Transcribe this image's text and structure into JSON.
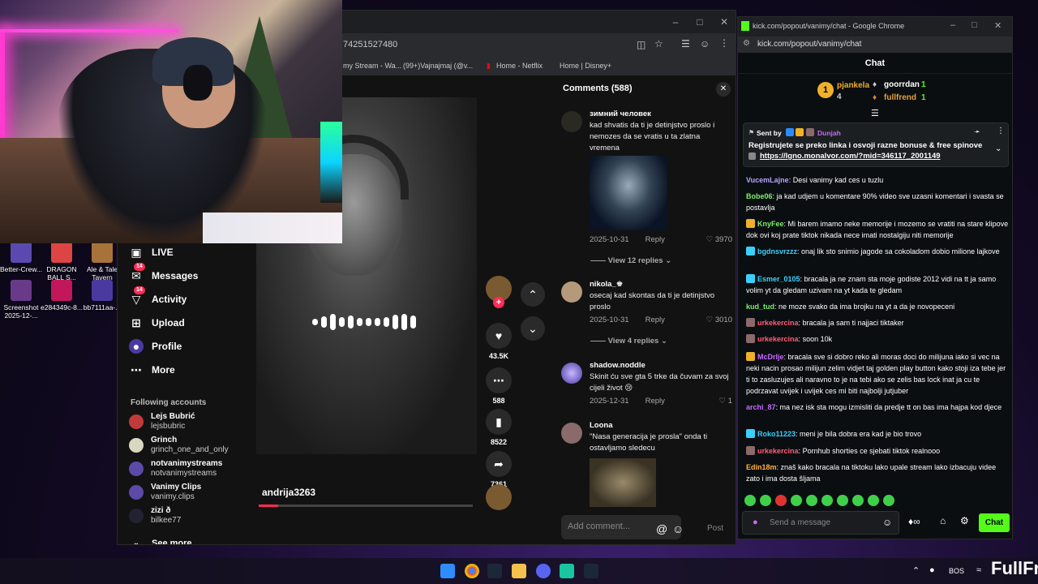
{
  "desktop_icons": [
    {
      "label": "Better-Crew..."
    },
    {
      "label": "DRAGON BALL S..."
    },
    {
      "label": "Ale & Tale Tavern"
    },
    {
      "label": "Screenshot 2025-12-..."
    },
    {
      "label": "e284349c-8..."
    },
    {
      "label": "bb7111aa-..."
    }
  ],
  "browser": {
    "url_fragment": "74251527480",
    "bookmarks": [
      "my Stream - Wa...",
      "(99+)Vajnajmaj (@v...",
      "Home - Netflix",
      "Home | Disney+"
    ]
  },
  "tiktok": {
    "nav": [
      {
        "label": "LIVE",
        "icon": "live-icon"
      },
      {
        "label": "Messages",
        "icon": "messages-icon",
        "badge": "14"
      },
      {
        "label": "Activity",
        "icon": "activity-icon",
        "badge": "14"
      },
      {
        "label": "Upload",
        "icon": "upload-icon"
      },
      {
        "label": "Profile",
        "icon": "profile-icon"
      },
      {
        "label": "More",
        "icon": "more-icon"
      }
    ],
    "following_header": "Following accounts",
    "following": [
      {
        "name": "Lejs Bubrić",
        "handle": "lejsbubric"
      },
      {
        "name": "Grinch",
        "handle": "grinch_one_and_only"
      },
      {
        "name": "notvanimystreams",
        "handle": "notvanimystreams"
      },
      {
        "name": "Vanimy Clips",
        "handle": "vanimy.clips"
      },
      {
        "name": "zizi ð",
        "handle": "bilkee77"
      }
    ],
    "see_more": "See more",
    "video_author": "andrija3263",
    "video_progress": 0.09,
    "actions": {
      "likes": "43.5K",
      "comments": "588",
      "saves": "8522",
      "shares": "7361"
    },
    "comments_header": "Comments (588)",
    "comments": [
      {
        "user": "зимний человек",
        "text": "kad shvatis da ti je detinjstvo proslo i nemozes da se vratis u ta zlatna vremena",
        "date": "2025-10-31",
        "reply": "Reply",
        "likes": "3970",
        "view_replies": "View 12 replies"
      },
      {
        "user": "nikola_♚",
        "text": "osecaj kad skontas da ti je detinjstvo proslo",
        "date": "2025-10-31",
        "reply": "Reply",
        "likes": "3010",
        "view_replies": "View 4 replies"
      },
      {
        "user": "shadow.noddle",
        "text": "Skinit ću sve gta 5 trke da čuvam za svoj cijeli život 😢",
        "date": "2025-12-31",
        "reply": "Reply",
        "likes": "1"
      },
      {
        "user": "Loona",
        "text": "\"Nasa generacija je prosla\" onda ti ostavljamo sledecu"
      }
    ],
    "add_comment_placeholder": "Add comment...",
    "post_label": "Post"
  },
  "chat": {
    "window_title": "kick.com/popout/vanimy/chat - Google Chrome",
    "url": "kick.com/popout/vanimy/chat",
    "header": "Chat",
    "leaderboard": [
      {
        "rank": "1",
        "name": "pjankela",
        "count": "4"
      },
      {
        "name": "goorrdan",
        "count": "1"
      },
      {
        "name": "fullfrend",
        "count": "1"
      }
    ],
    "pinned": {
      "sent_by_label": "Sent by",
      "sender": "Dunjah",
      "text": "Registrujete se preko linka i osvoji razne bonuse & free spinove",
      "link": "https://lgno.monalvor.com/?mid=346117_2001149"
    },
    "messages": [
      {
        "user": "VucemLajne",
        "color": "#b9a3ff",
        "text": "Desi vanimy kad ces u tuzlu"
      },
      {
        "user": "Bobe06",
        "color": "#7cf06b",
        "text": "ja kad udjem u komentare 90% video sve uzasni komentari i svasta se postavlja"
      },
      {
        "user": "KnyFee",
        "color": "#7cf06b",
        "text": "Mi barem imamo neke memorije i mozemo se vratiti na stare klipove dok ovi koj prate tiktok nikada nece imati nostalgiju niti memorije"
      },
      {
        "user": "bgdnsvrzzz",
        "color": "#39d0ff",
        "text": "onaj lik sto snimio jagode sa cokoladom dobio milione lajkove"
      },
      {
        "user": "Esmer_0105",
        "color": "#39d0ff",
        "text": "bracala ja ne znam sta moje godiste 2012 vidi na tt ja samo volim yt da gledam uzivam na yt kada te gledam"
      },
      {
        "user": "kud_tud",
        "color": "#7cf06b",
        "text": "ne moze svako da ima brojku na yt a da je novopeceni"
      },
      {
        "user": "urkekercina",
        "color": "#ff5c7a",
        "text": "bracala ja sam ti najjaci tiktaker"
      },
      {
        "user": "urkekercina",
        "color": "#ff5c7a",
        "text": "soon 10k"
      },
      {
        "user": "McDrlje",
        "color": "#c76bff",
        "text": "bracala sve si dobro reko ali moras doci do milijuna iako si vec na neki nacin prosao milijun zelim vidjet taj golden play button kako stoji iza tebe jer ti to zasluzujes ali naravno to je na tebi ako se zelis bas lock inat ja cu te podrzavat uvijek i uvijek ces mi biti najbolji jutjuber"
      },
      {
        "user": "archi_87",
        "color": "#c76bff",
        "text": "ma nez isk sta mogu izmisliti da predje tt on bas ima hajpa kod djece"
      },
      {
        "user": "Roko11223",
        "color": "#39d0ff",
        "text": "meni je bila dobra era kad je bio trovo"
      },
      {
        "user": "urkekercina",
        "color": "#ff5c7a",
        "text": "Pornhub shorties ce sjebati tiktok realnooo"
      },
      {
        "user": "Edin18m",
        "color": "#ffb347",
        "text": "znaš kako bracala na tiktoku lako upale stream lako izbacuju videe zato i ima dosta šljama"
      }
    ],
    "send_placeholder": "Send a message",
    "chat_button": "Chat"
  },
  "taskbar": {
    "lang": "BOS",
    "watermark": "FullFr"
  }
}
